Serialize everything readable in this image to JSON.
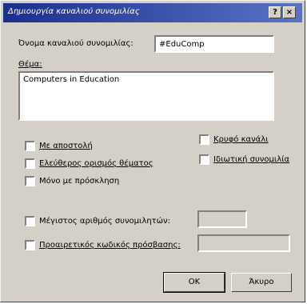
{
  "window": {
    "title": "Δημιουργία καναλιού συνομιλίας",
    "help_glyph": "?",
    "close_glyph": "×"
  },
  "form": {
    "channel_name_label": "Όνομα καναλιού συνομιλίας:",
    "channel_name_value": "#EduComp",
    "topic_label": "Θέμα:",
    "topic_value": "Computers in Education"
  },
  "options": {
    "moderated": {
      "label": "Με αποστολή",
      "checked": false
    },
    "free_topic": {
      "label": "Ελεύθερος ορισμός θέματος",
      "checked": false
    },
    "invite_only": {
      "label": "Μόνο με πρόσκληση",
      "checked": false
    },
    "hidden_channel": {
      "label": "Κρυφό κανάλι",
      "checked": false
    },
    "private_chat": {
      "label": "Ιδιωτική συνομιλία",
      "checked": false
    },
    "max_users": {
      "label": "Μέγιστος αριθμός συνομιλητών:",
      "checked": false,
      "value": ""
    },
    "password": {
      "label": "Προαιρετικός κωδικός πρόσβασης:",
      "checked": false,
      "value": ""
    }
  },
  "buttons": {
    "ok_label": "OK",
    "cancel_label": "Άκυρο"
  },
  "colors": {
    "titlebar_start": "#1c2e8c",
    "titlebar_end": "#5a73c4",
    "dialog_bg": "#d4d0c8"
  }
}
